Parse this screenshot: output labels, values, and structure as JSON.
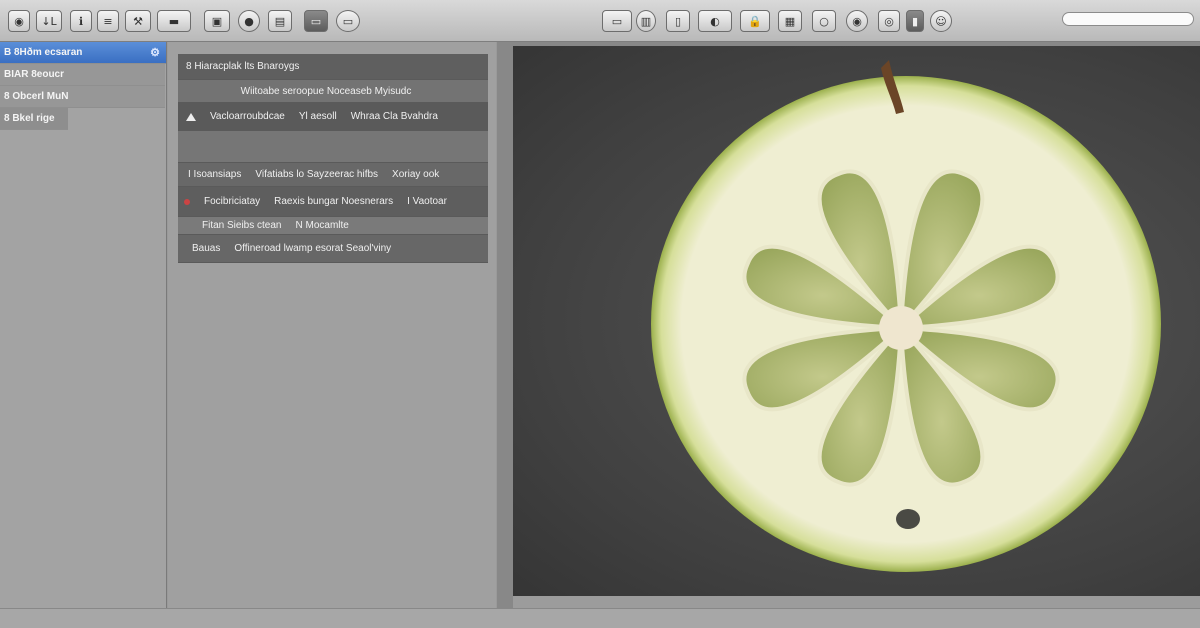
{
  "toolbar": {
    "left_buttons": [
      {
        "name": "back-icon",
        "glyph": "◉"
      },
      {
        "name": "sort-icon",
        "glyph": "↓L"
      },
      {
        "name": "info-icon",
        "glyph": "ℹ"
      },
      {
        "name": "list-view-icon",
        "glyph": "≡"
      },
      {
        "name": "tools-icon",
        "glyph": "⚒"
      },
      {
        "name": "display-icon",
        "glyph": "▬"
      },
      {
        "name": "picture-icon",
        "glyph": "▣"
      },
      {
        "name": "circle-icon",
        "glyph": "●"
      },
      {
        "name": "document-icon",
        "glyph": "▤"
      },
      {
        "name": "screen-icon",
        "glyph": "▭"
      },
      {
        "name": "window-icon",
        "glyph": "▭"
      }
    ],
    "right_buttons": [
      {
        "name": "monitor-icon",
        "glyph": "▭"
      },
      {
        "name": "chart-icon",
        "glyph": "▥"
      },
      {
        "name": "phone-icon",
        "glyph": "▯"
      },
      {
        "name": "toggle-icon",
        "glyph": "◐"
      },
      {
        "name": "lock-icon",
        "glyph": "🔒"
      },
      {
        "name": "grid-icon",
        "glyph": "▦"
      },
      {
        "name": "round-icon",
        "glyph": "○"
      },
      {
        "name": "camera-icon",
        "glyph": "◉"
      },
      {
        "name": "eye-icon",
        "glyph": "◎"
      },
      {
        "name": "panel-icon",
        "glyph": "▮"
      },
      {
        "name": "emoji-icon",
        "glyph": "☺"
      }
    ],
    "search_placeholder": ""
  },
  "sidebar": {
    "items": [
      {
        "label": "B 8Hðm ecsaran",
        "selected": true
      },
      {
        "label": "BIAR 8eoucr",
        "selected": false
      },
      {
        "label": "8 Obcerl MuN",
        "selected": false
      },
      {
        "label": "8 Bkel rige",
        "selected": false
      }
    ]
  },
  "panel": {
    "rows": [
      {
        "cells": [
          "8 Hiaracplak lts Bnaroygs"
        ]
      },
      {
        "cells": [
          "Wiitoabe seroopue Noceaseb Myisudc"
        ]
      },
      {
        "cells": [
          "Vacloarroubdcae",
          "Yl aesoll",
          "Whraa Cla Bvahdra"
        ]
      },
      {
        "cells": [
          ""
        ]
      },
      {
        "cells": [
          "I Isoansiaps",
          "Vifatiabs lo Sayzeerac hifbs",
          "Xoriay ook"
        ]
      },
      {
        "cells": [
          "Focibriciatay",
          "Raexis bungar Noesnerars",
          "I Vaotoar"
        ]
      },
      {
        "cells": [
          "Fitan Sieibs ctean",
          "N Mocamlte"
        ]
      },
      {
        "cells": [
          "Bauas",
          "Offineroad lwamp esorat Seaol'viny"
        ]
      }
    ]
  },
  "colors": {
    "selection": "#3a6fc2",
    "canvas": "#454545",
    "apple_flesh": "#a9b56a",
    "apple_rind": "#c8d88a"
  }
}
